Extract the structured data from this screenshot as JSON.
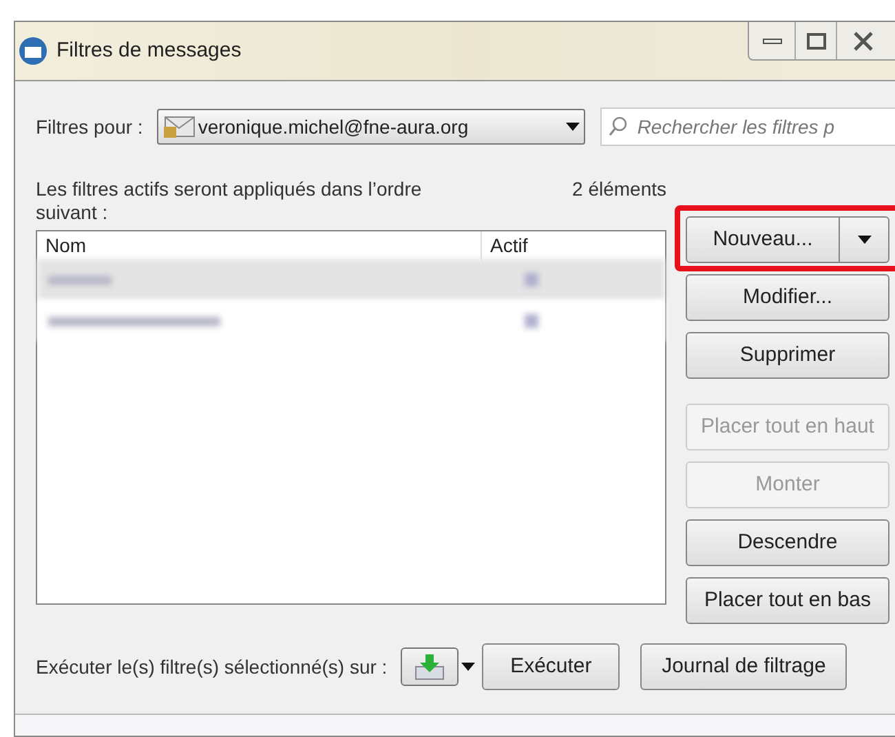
{
  "window": {
    "title": "Filtres de messages"
  },
  "filters_for": {
    "label": "Filtres pour :",
    "account": "veronique.michel@fne-aura.org"
  },
  "search": {
    "placeholder": "Rechercher les filtres p"
  },
  "list_caption": "Les filtres actifs seront appliqués dans l’ordre suivant :",
  "count": "2 éléments",
  "table": {
    "columns": [
      "Nom",
      "Actif"
    ],
    "rows": [
      {
        "kind": "redacted",
        "selected": true
      },
      {
        "kind": "redacted",
        "selected": false
      }
    ]
  },
  "new_button": {
    "label": "Nouveau...",
    "highlighted": true
  },
  "buttons": [
    {
      "label": "Modifier...",
      "disabled": false
    },
    {
      "label": "Supprimer",
      "disabled": false
    },
    {
      "label": "Placer tout en haut",
      "disabled": true
    },
    {
      "label": "Monter",
      "disabled": true
    },
    {
      "label": "Descendre",
      "disabled": false
    },
    {
      "label": "Placer tout en bas",
      "disabled": false
    }
  ],
  "run": {
    "label": "Exécuter le(s) filtre(s) sélectionné(s) sur :",
    "button": "Exécuter"
  },
  "log_button": "Journal de filtrage"
}
